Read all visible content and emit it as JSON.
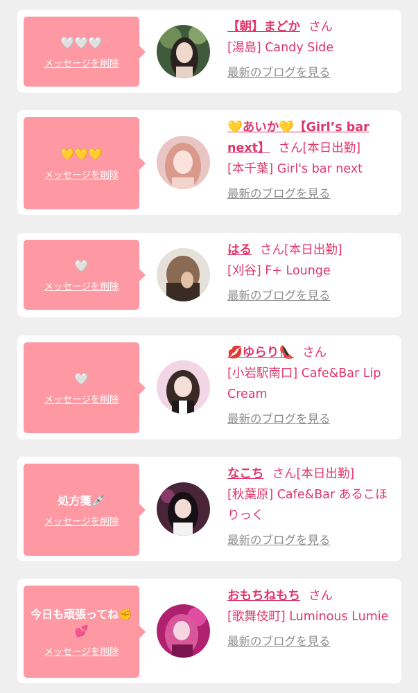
{
  "messages": [
    {
      "message": "🤍🤍🤍",
      "delete_label": "メッセージを削除",
      "cast_name": "【朝】まどか",
      "honorific": "さん",
      "status": "",
      "shop": "[湯島] Candy Side",
      "blog_label": "最新のブログを見る"
    },
    {
      "message": "💛💛💛",
      "delete_label": "メッセージを削除",
      "cast_name": "💛あいか💛【Girl’s bar next】",
      "honorific": "さん",
      "status": "[本日出勤]",
      "shop": "[本千葉] Girl's bar next",
      "blog_label": "最新のブログを見る"
    },
    {
      "message": "🤍",
      "delete_label": "メッセージを削除",
      "cast_name": "はる",
      "honorific": "さん",
      "status": "[本日出勤]",
      "shop": "[刈谷] F+ Lounge",
      "blog_label": "最新のブログを見る"
    },
    {
      "message": "🤍",
      "delete_label": "メッセージを削除",
      "cast_name": "💋ゆらり👠",
      "honorific": "さん",
      "status": "",
      "shop": "[小岩駅南口] Cafe&Bar Lip Cream",
      "blog_label": "最新のブログを見る"
    },
    {
      "message": "処方箋💉",
      "delete_label": "メッセージを削除",
      "cast_name": "なこち",
      "honorific": "さん",
      "status": "[本日出勤]",
      "shop": "[秋葉原] Cafe&Bar あるこほりっく",
      "blog_label": "最新のブログを見る"
    },
    {
      "message": "今日も頑張ってね✊💕",
      "delete_label": "メッセージを削除",
      "cast_name": "おもちねもち",
      "honorific": "さん",
      "status": "",
      "shop": "[歌舞伎町] Luminous Lumie",
      "blog_label": "最新のブログを見る"
    }
  ],
  "colors": {
    "page_bg": "#efefef",
    "bubble": "#fe98a2",
    "accent_text": "#e0366a",
    "link_gray": "#8d8d8d"
  }
}
